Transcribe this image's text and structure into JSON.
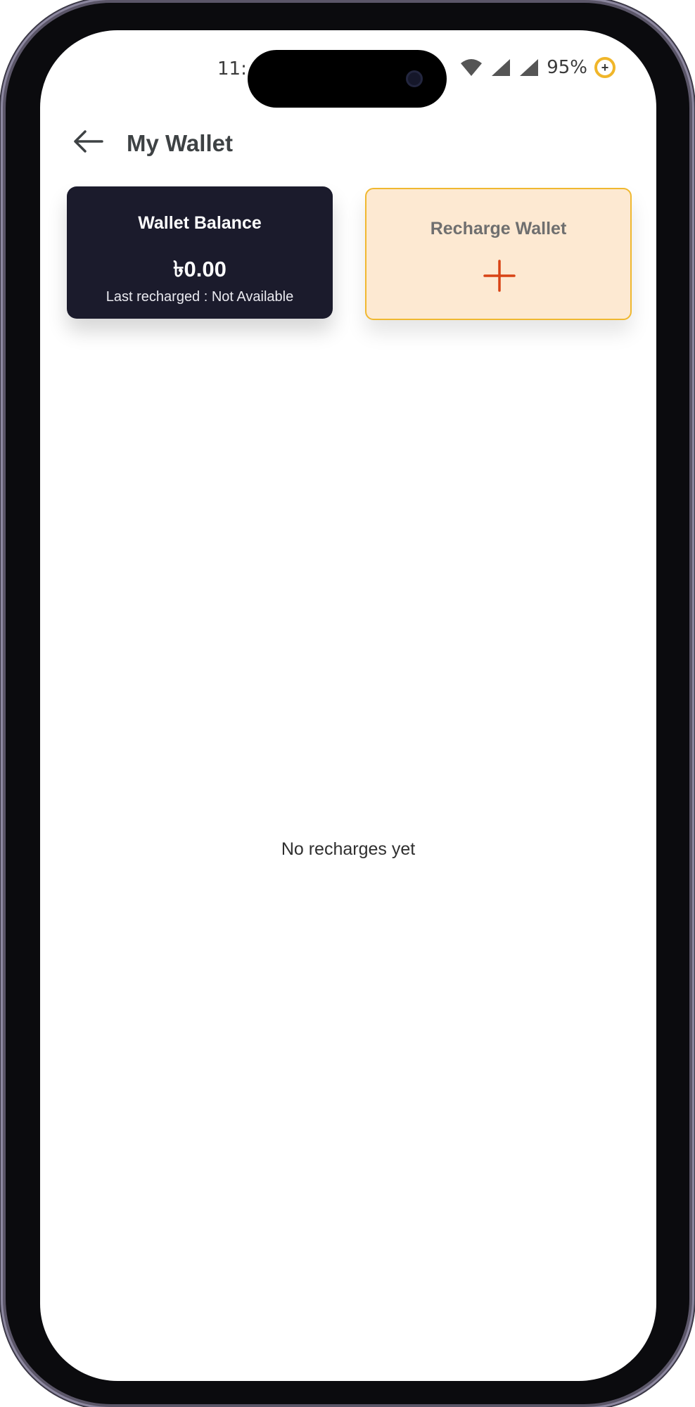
{
  "status_bar": {
    "time": "11:",
    "battery": "95%",
    "battery_icon_symbol": "+"
  },
  "header": {
    "title": "My Wallet",
    "back_icon": "arrow-left-icon"
  },
  "balance_card": {
    "title": "Wallet Balance",
    "amount": "৳0.00",
    "last_recharged": "Last recharged : Not Available"
  },
  "recharge_card": {
    "title": "Recharge Wallet",
    "icon": "plus-icon"
  },
  "empty_state": {
    "message": "No recharges yet"
  },
  "colors": {
    "balance_card_bg": "#1b1b2c",
    "recharge_card_bg": "#fde9d2",
    "recharge_card_border": "#f0b830",
    "plus_accent": "#d84315"
  }
}
